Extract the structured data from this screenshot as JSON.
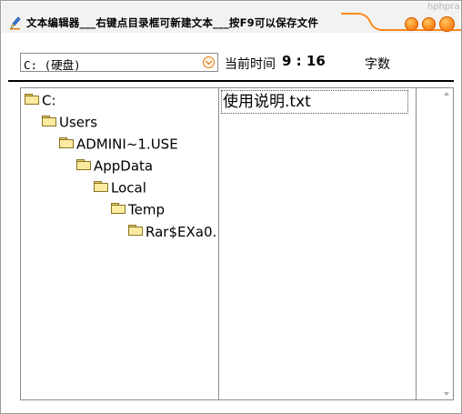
{
  "window": {
    "title": "文本编辑器___右键点目录框可新建文本___按F9可以保存文件",
    "background_fragment": "hphpra",
    "accent_color": "#ff8a1a",
    "icon": "app-pen-icon"
  },
  "title_buttons": [
    {
      "name": "minimize",
      "icon": "orange-dot-icon"
    },
    {
      "name": "maximize",
      "icon": "orange-dot-icon"
    },
    {
      "name": "close",
      "icon": "orange-dot-icon"
    }
  ],
  "toolbar": {
    "drive_value": "C: (硬盘)",
    "dropdown_icon": "chevron-down-icon",
    "time_label": "当前时间",
    "time_value": "9 : 16",
    "chars_label": "字数"
  },
  "tree": {
    "folder_icon": "folder-icon",
    "items": [
      {
        "label": "C:",
        "depth": 0
      },
      {
        "label": "Users",
        "depth": 1
      },
      {
        "label": "ADMINI~1.USE",
        "depth": 2
      },
      {
        "label": "AppData",
        "depth": 3
      },
      {
        "label": "Local",
        "depth": 4
      },
      {
        "label": "Temp",
        "depth": 5
      },
      {
        "label": "Rar$EXa0.",
        "depth": 6,
        "selected": true
      }
    ]
  },
  "files": [
    {
      "label": "使用说明.txt"
    }
  ]
}
